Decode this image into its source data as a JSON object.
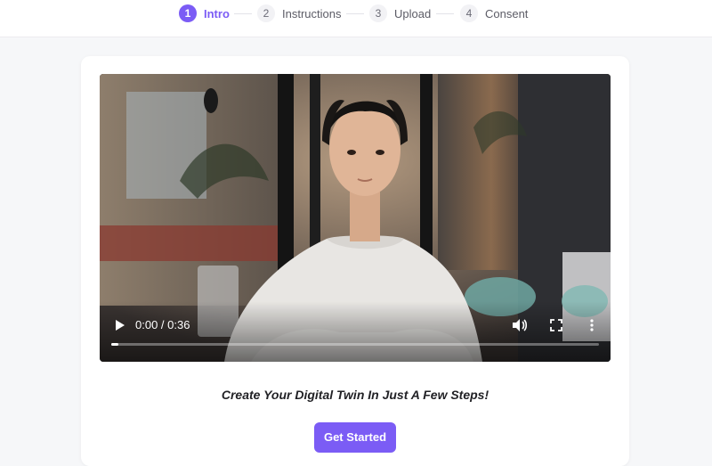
{
  "stepper": {
    "steps": [
      {
        "number": "1",
        "label": "Intro",
        "active": true
      },
      {
        "number": "2",
        "label": "Instructions",
        "active": false
      },
      {
        "number": "3",
        "label": "Upload",
        "active": false
      },
      {
        "number": "4",
        "label": "Consent",
        "active": false
      }
    ]
  },
  "video": {
    "time_display": "0:00 / 0:36",
    "progress": 0.0,
    "icons": [
      "play-icon",
      "volume-icon",
      "fullscreen-icon",
      "more-options-icon"
    ]
  },
  "content": {
    "tagline": "Create Your Digital Twin In Just A Few Steps!",
    "cta_label": "Get Started"
  },
  "colors": {
    "accent": "#7b5cf5",
    "page_bg": "#f6f7f9",
    "card_bg": "#ffffff"
  }
}
